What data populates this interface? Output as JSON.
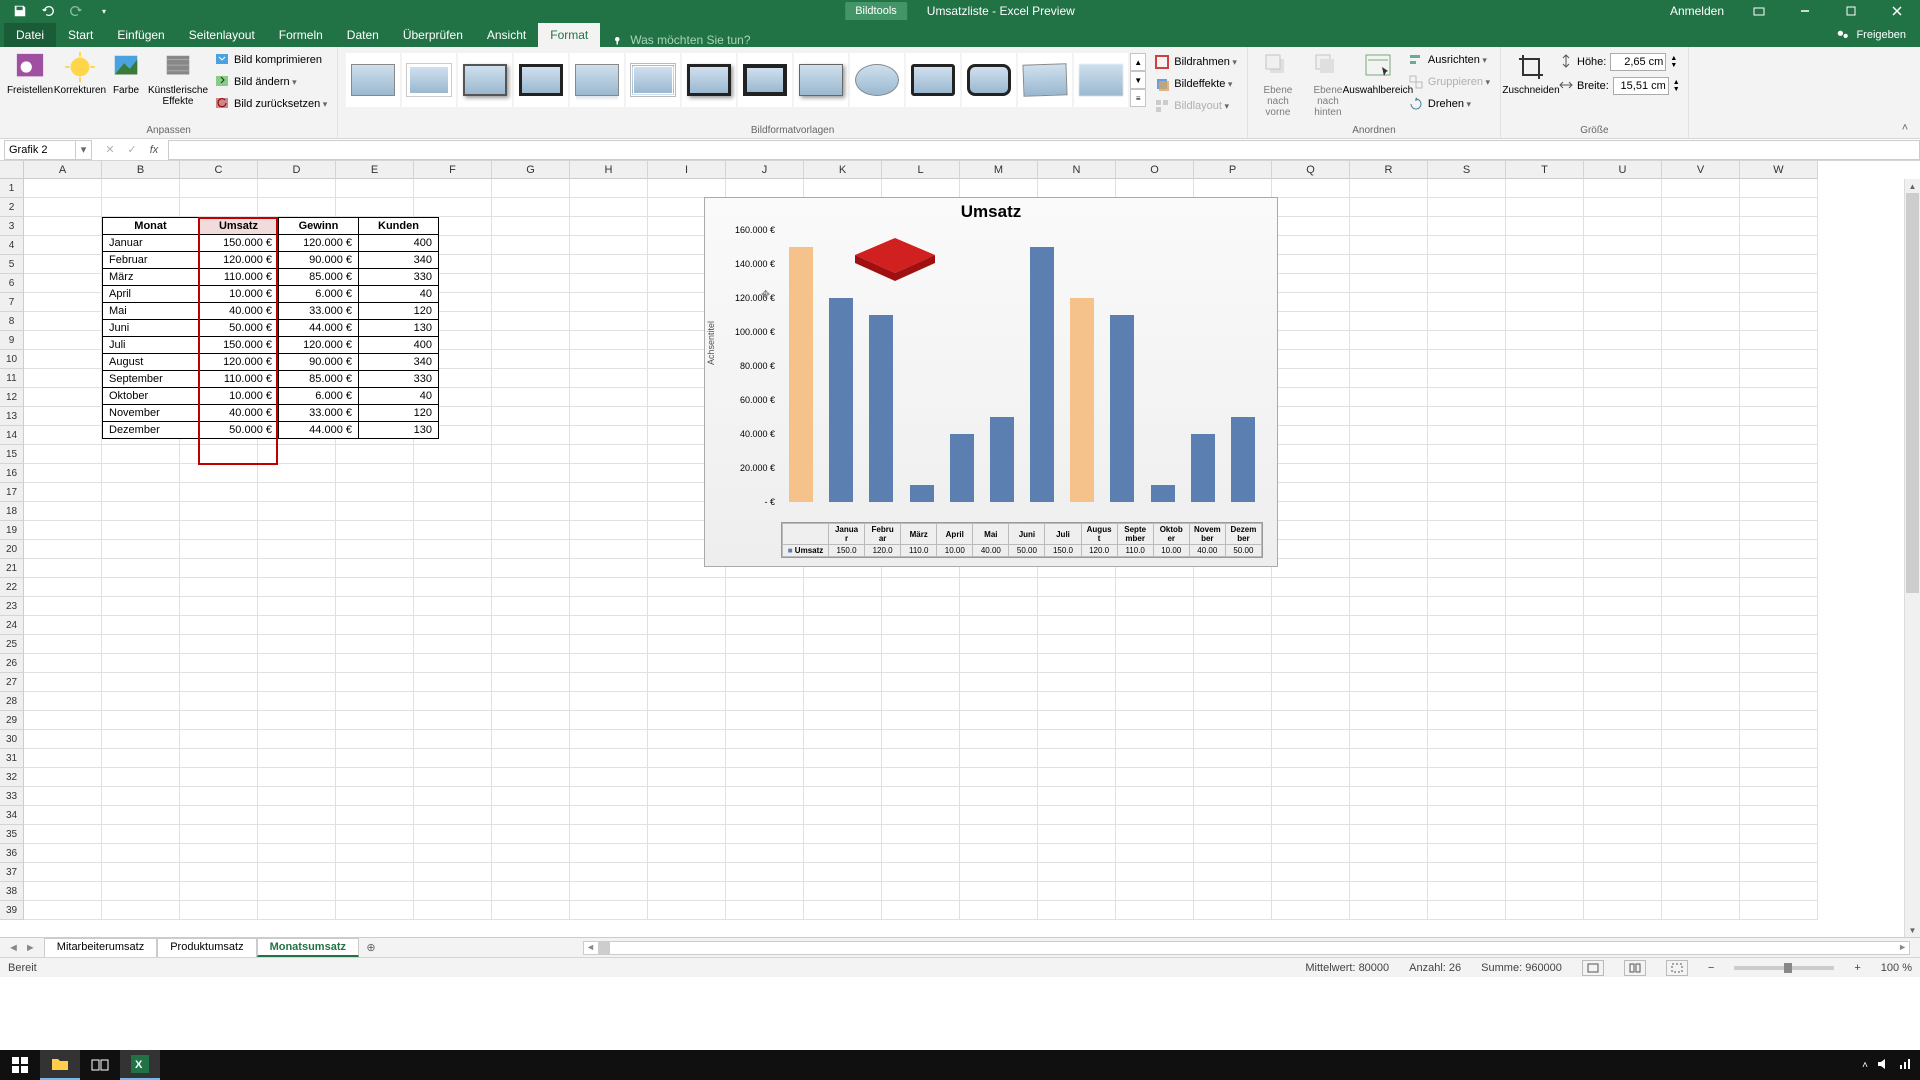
{
  "titlebar": {
    "tooltab": "Bildtools",
    "doc": "Umsatzliste - Excel Preview",
    "signin": "Anmelden"
  },
  "ribbon_tabs": {
    "file": "Datei",
    "items": [
      "Start",
      "Einfügen",
      "Seitenlayout",
      "Formeln",
      "Daten",
      "Überprüfen",
      "Ansicht",
      "Format"
    ],
    "active": "Format",
    "tellme": "Was möchten Sie tun?",
    "share": "Freigeben"
  },
  "ribbon": {
    "anpassen": {
      "label": "Anpassen",
      "freistellen": "Freistellen",
      "korrekturen": "Korrekturen",
      "farbe": "Farbe",
      "kuenstl": "Künstlerische Effekte",
      "kompr": "Bild komprimieren",
      "aendern": "Bild ändern",
      "zurueck": "Bild zurücksetzen"
    },
    "formatvorlagen": {
      "label": "Bildformatvorlagen"
    },
    "bildrahmen": "Bildrahmen",
    "bildeffekte": "Bildeffekte",
    "bildlayout": "Bildlayout",
    "vorne": "Ebene nach vorne",
    "hinten": "Ebene nach hinten",
    "auswahl": "Auswahlbereich",
    "ausrichten": "Ausrichten",
    "gruppieren": "Gruppieren",
    "drehen": "Drehen",
    "anordnen": "Anordnen",
    "zuschneiden": "Zuschneiden",
    "groesse": "Größe",
    "hoehe": "Höhe:",
    "breite": "Breite:",
    "h_val": "2,65 cm",
    "b_val": "15,51 cm"
  },
  "namebox": "Grafik 2",
  "columns": [
    "A",
    "B",
    "C",
    "D",
    "E",
    "F",
    "G",
    "H",
    "I",
    "J",
    "K",
    "L",
    "M",
    "N",
    "O",
    "P",
    "Q",
    "R",
    "S",
    "T",
    "U",
    "V",
    "W"
  ],
  "row_count": 39,
  "table": {
    "headers": [
      "Monat",
      "Umsatz",
      "Gewinn",
      "Kunden"
    ],
    "rows": [
      [
        "Januar",
        "150.000 €",
        "120.000 €",
        "400"
      ],
      [
        "Februar",
        "120.000 €",
        "90.000 €",
        "340"
      ],
      [
        "März",
        "110.000 €",
        "85.000 €",
        "330"
      ],
      [
        "April",
        "10.000 €",
        "6.000 €",
        "40"
      ],
      [
        "Mai",
        "40.000 €",
        "33.000 €",
        "120"
      ],
      [
        "Juni",
        "50.000 €",
        "44.000 €",
        "130"
      ],
      [
        "Juli",
        "150.000 €",
        "120.000 €",
        "400"
      ],
      [
        "August",
        "120.000 €",
        "90.000 €",
        "340"
      ],
      [
        "September",
        "110.000 €",
        "85.000 €",
        "330"
      ],
      [
        "Oktober",
        "10.000 €",
        "6.000 €",
        "40"
      ],
      [
        "November",
        "40.000 €",
        "33.000 €",
        "120"
      ],
      [
        "Dezember",
        "50.000 €",
        "44.000 €",
        "130"
      ]
    ]
  },
  "chart": {
    "title": "Umsatz",
    "ylabel": "Achsentitel",
    "yticks": [
      "- €",
      "20.000 €",
      "40.000 €",
      "60.000 €",
      "80.000 €",
      "100.000 €",
      "120.000 €",
      "140.000 €",
      "160.000 €"
    ],
    "dt_head": "Umsatz",
    "dt_vals": [
      "150.0",
      "120.0",
      "110.0",
      "10.00",
      "40.00",
      "50.00",
      "150.0",
      "120.0",
      "110.0",
      "10.00",
      "40.00",
      "50.00"
    ],
    "cat_short": [
      "Januar",
      "Februar",
      "März",
      "April",
      "Mai",
      "Juni",
      "Juli",
      "August",
      "September",
      "Oktober",
      "November",
      "Dezember"
    ]
  },
  "chart_data": {
    "type": "bar",
    "title": "Umsatz",
    "ylabel": "Achsentitel",
    "ylim": [
      0,
      160000
    ],
    "categories": [
      "Januar",
      "Februar",
      "März",
      "April",
      "Mai",
      "Juni",
      "Juli",
      "August",
      "September",
      "Oktober",
      "November",
      "Dezember"
    ],
    "series": [
      {
        "name": "Umsatz",
        "values": [
          150000,
          120000,
          110000,
          10000,
          40000,
          50000,
          150000,
          120000,
          110000,
          10000,
          40000,
          50000
        ]
      }
    ],
    "highlighted": [
      "Januar",
      "August"
    ]
  },
  "sheets": {
    "items": [
      "Mitarbeiterumsatz",
      "Produktumsatz",
      "Monatsumsatz"
    ],
    "active": "Monatsumsatz"
  },
  "status": {
    "ready": "Bereit",
    "avg_l": "Mittelwert:",
    "avg_v": "80000",
    "cnt_l": "Anzahl:",
    "cnt_v": "26",
    "sum_l": "Summe:",
    "sum_v": "960000",
    "zoom": "100 %"
  }
}
